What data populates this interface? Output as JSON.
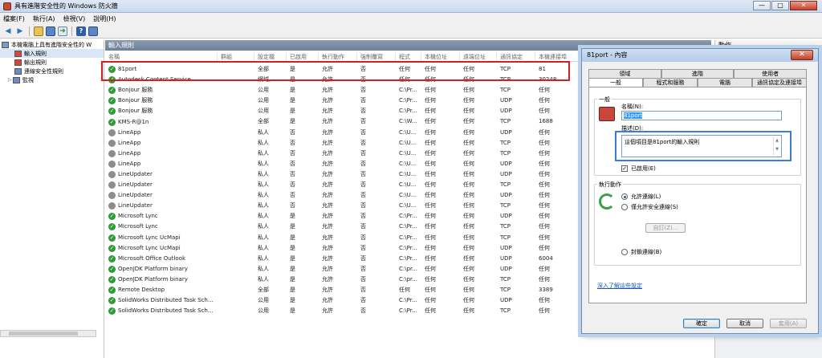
{
  "window": {
    "title": "具有進階安全性的 Windows 防火牆",
    "min": "—",
    "max": "□",
    "close": "✕"
  },
  "menu": [
    "檔案(F)",
    "執行(A)",
    "檢視(V)",
    "說明(H)"
  ],
  "tree": {
    "root": "本機電腦上具有進階安全性的 W",
    "items": [
      "輸入規則",
      "輸出規則",
      "連線安全性規則",
      "監視"
    ]
  },
  "pane": {
    "title": "輸入規則"
  },
  "columns": [
    "名稱",
    "群組",
    "設定檔",
    "已啟用",
    "執行動作",
    "強制覆寫",
    "程式",
    "本機位址",
    "遠端位址",
    "通訊協定",
    "本機連接埠"
  ],
  "rules": [
    {
      "name": "81port",
      "profile": "全部",
      "enabled": "是",
      "action": "允許",
      "override": "否",
      "program": "任何",
      "local": "任何",
      "remote": "任何",
      "protocol": "TCP",
      "port": "81",
      "icon": "green"
    },
    {
      "name": "Autodesk Content Service",
      "profile": "網域,...",
      "enabled": "是",
      "action": "允許",
      "override": "否",
      "program": "任何",
      "local": "任何",
      "remote": "任何",
      "protocol": "TCP",
      "port": "30248",
      "icon": "green"
    },
    {
      "name": "Bonjour 服務",
      "profile": "公用",
      "enabled": "是",
      "action": "允許",
      "override": "否",
      "program": "C:\\Pr...",
      "local": "任何",
      "remote": "任何",
      "protocol": "TCP",
      "port": "任何",
      "icon": "green"
    },
    {
      "name": "Bonjour 服務",
      "profile": "公用",
      "enabled": "是",
      "action": "允許",
      "override": "否",
      "program": "C:\\Pr...",
      "local": "任何",
      "remote": "任何",
      "protocol": "UDP",
      "port": "任何",
      "icon": "green"
    },
    {
      "name": "Bonjour 服務",
      "profile": "公用",
      "enabled": "是",
      "action": "允許",
      "override": "否",
      "program": "C:\\Pr...",
      "local": "任何",
      "remote": "任何",
      "protocol": "UDP",
      "port": "任何",
      "icon": "green"
    },
    {
      "name": "KMS-R@1n",
      "profile": "全部",
      "enabled": "是",
      "action": "允許",
      "override": "否",
      "program": "C:\\W...",
      "local": "任何",
      "remote": "任何",
      "protocol": "TCP",
      "port": "1688",
      "icon": "green"
    },
    {
      "name": "LineApp",
      "profile": "私人",
      "enabled": "否",
      "action": "允許",
      "override": "否",
      "program": "C:\\U...",
      "local": "任何",
      "remote": "任何",
      "protocol": "UDP",
      "port": "任何",
      "icon": "gray"
    },
    {
      "name": "LineApp",
      "profile": "私人",
      "enabled": "否",
      "action": "允許",
      "override": "否",
      "program": "C:\\U...",
      "local": "任何",
      "remote": "任何",
      "protocol": "TCP",
      "port": "任何",
      "icon": "gray"
    },
    {
      "name": "LineApp",
      "profile": "私人",
      "enabled": "否",
      "action": "允許",
      "override": "否",
      "program": "C:\\U...",
      "local": "任何",
      "remote": "任何",
      "protocol": "TCP",
      "port": "任何",
      "icon": "gray"
    },
    {
      "name": "LineApp",
      "profile": "私人",
      "enabled": "否",
      "action": "允許",
      "override": "否",
      "program": "C:\\U...",
      "local": "任何",
      "remote": "任何",
      "protocol": "UDP",
      "port": "任何",
      "icon": "gray"
    },
    {
      "name": "LineUpdater",
      "profile": "私人",
      "enabled": "否",
      "action": "允許",
      "override": "否",
      "program": "C:\\U...",
      "local": "任何",
      "remote": "任何",
      "protocol": "UDP",
      "port": "任何",
      "icon": "gray"
    },
    {
      "name": "LineUpdater",
      "profile": "私人",
      "enabled": "否",
      "action": "允許",
      "override": "否",
      "program": "C:\\U...",
      "local": "任何",
      "remote": "任何",
      "protocol": "TCP",
      "port": "任何",
      "icon": "gray"
    },
    {
      "name": "LineUpdater",
      "profile": "私人",
      "enabled": "否",
      "action": "允許",
      "override": "否",
      "program": "C:\\U...",
      "local": "任何",
      "remote": "任何",
      "protocol": "UDP",
      "port": "任何",
      "icon": "gray"
    },
    {
      "name": "LineUpdater",
      "profile": "私人",
      "enabled": "否",
      "action": "允許",
      "override": "否",
      "program": "C:\\U...",
      "local": "任何",
      "remote": "任何",
      "protocol": "TCP",
      "port": "任何",
      "icon": "gray"
    },
    {
      "name": "Microsoft Lync",
      "profile": "私人",
      "enabled": "是",
      "action": "允許",
      "override": "否",
      "program": "C:\\Pr...",
      "local": "任何",
      "remote": "任何",
      "protocol": "UDP",
      "port": "任何",
      "icon": "green"
    },
    {
      "name": "Microsoft Lync",
      "profile": "私人",
      "enabled": "是",
      "action": "允許",
      "override": "否",
      "program": "C:\\Pr...",
      "local": "任何",
      "remote": "任何",
      "protocol": "TCP",
      "port": "任何",
      "icon": "green"
    },
    {
      "name": "Microsoft Lync UcMapi",
      "profile": "私人",
      "enabled": "是",
      "action": "允許",
      "override": "否",
      "program": "C:\\Pr...",
      "local": "任何",
      "remote": "任何",
      "protocol": "TCP",
      "port": "任何",
      "icon": "green"
    },
    {
      "name": "Microsoft Lync UcMapi",
      "profile": "私人",
      "enabled": "是",
      "action": "允許",
      "override": "否",
      "program": "C:\\Pr...",
      "local": "任何",
      "remote": "任何",
      "protocol": "UDP",
      "port": "任何",
      "icon": "green"
    },
    {
      "name": "Microsoft Office Outlook",
      "profile": "私人",
      "enabled": "是",
      "action": "允許",
      "override": "否",
      "program": "C:\\Pr...",
      "local": "任何",
      "remote": "任何",
      "protocol": "UDP",
      "port": "6004",
      "icon": "green"
    },
    {
      "name": "OpenJDK Platform binary",
      "profile": "私人",
      "enabled": "是",
      "action": "允許",
      "override": "否",
      "program": "C:\\pr...",
      "local": "任何",
      "remote": "任何",
      "protocol": "UDP",
      "port": "任何",
      "icon": "green"
    },
    {
      "name": "OpenJDK Platform binary",
      "profile": "私人",
      "enabled": "是",
      "action": "允許",
      "override": "否",
      "program": "C:\\pr...",
      "local": "任何",
      "remote": "任何",
      "protocol": "TCP",
      "port": "任何",
      "icon": "green"
    },
    {
      "name": "Remote Desktop",
      "profile": "全部",
      "enabled": "是",
      "action": "允許",
      "override": "否",
      "program": "任何",
      "local": "任何",
      "remote": "任何",
      "protocol": "TCP",
      "port": "3389",
      "icon": "green"
    },
    {
      "name": "SolidWorks Distributed Task Sch...",
      "profile": "公用",
      "enabled": "是",
      "action": "允許",
      "override": "否",
      "program": "C:\\Pr...",
      "local": "任何",
      "remote": "任何",
      "protocol": "UDP",
      "port": "任何",
      "icon": "green"
    },
    {
      "name": "SolidWorks Distributed Task Sch...",
      "profile": "公用",
      "enabled": "是",
      "action": "允許",
      "override": "否",
      "program": "C:\\Pr...",
      "local": "任何",
      "remote": "任何",
      "protocol": "TCP",
      "port": "任何",
      "icon": "green"
    }
  ],
  "actions": {
    "title": "動作"
  },
  "dialog": {
    "title": "81port - 內容",
    "close": "✕",
    "tabs_row1": [
      "領域",
      "進階",
      "使用者"
    ],
    "tabs_row2": [
      "一般",
      "程式和服務",
      "電腦",
      "通訊協定及連接埠"
    ],
    "general_group": "一般",
    "name_label": "名稱(N):",
    "name_value": "81port",
    "desc_label": "描述(D):",
    "desc_value": "這個項目是81port的輸入規則",
    "enabled_label": "已啟用(E)",
    "action_group": "執行動作",
    "allow_label": "允許連線(L)",
    "secure_label": "僅允許安全連線(S)",
    "customize_label": "自訂(Z)...",
    "block_label": "封鎖連線(B)",
    "learn_link": "深入了解這些設定",
    "ok": "確定",
    "cancel": "取消",
    "apply": "套用(A)"
  }
}
